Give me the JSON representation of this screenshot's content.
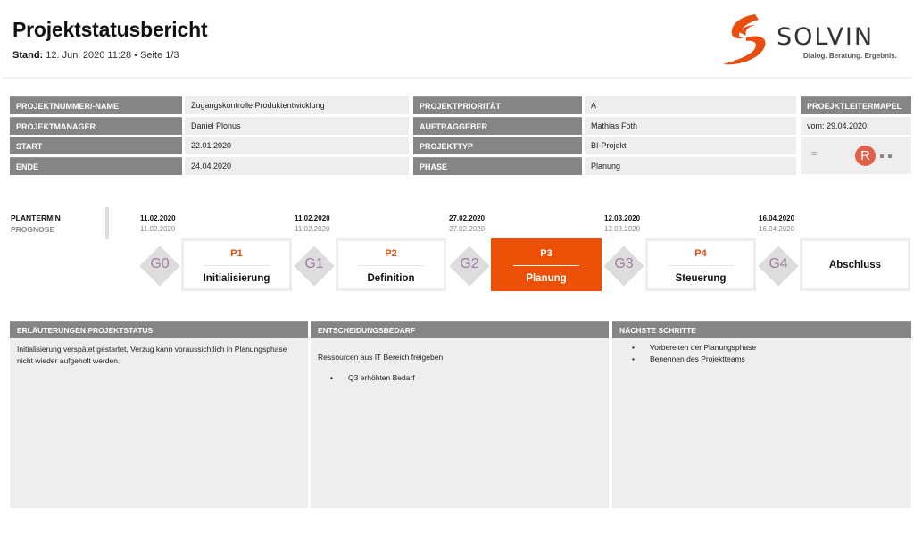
{
  "header": {
    "title": "Projektstatusbericht",
    "stand_label": "Stand:",
    "stand_value": " 12. Juni 2020 11:28 • Seite 1/3",
    "logo": {
      "brand": "SOLVIN",
      "tagline": "Dialog. Beratung. Ergebnis.",
      "brand_color": "#e84e0f"
    }
  },
  "info": {
    "left": [
      {
        "label": "PROJEKTNUMMER/-NAME",
        "value": "Zugangskontrolle Produktentwicklung"
      },
      {
        "label": "PROJEKTMANAGER",
        "value": "Daniel Plonus"
      },
      {
        "label": "START",
        "value": "22.01.2020"
      },
      {
        "label": "ENDE",
        "value": "24.04.2020"
      }
    ],
    "middle": [
      {
        "label": "PROJEKTPRIORITÄT",
        "value": "A"
      },
      {
        "label": "AUFTRAGGEBER",
        "value": "Mathias Foth"
      },
      {
        "label": "PROJEKTTYP",
        "value": "BI-Projekt"
      },
      {
        "label": "PHASE",
        "value": "Planung"
      }
    ],
    "ampel": {
      "label": "PROEJKTLEITERMAPEL",
      "date": "vom: 29.04.2020",
      "trend": "=",
      "status": "R",
      "status_color": "#e0604a"
    }
  },
  "timeline": {
    "plan_label": "PLANTERMIN",
    "prognose_label": "PROGNOSE",
    "gates": [
      {
        "id": "G0",
        "plan": "11.02.2020",
        "prognose": "11.02.2020"
      },
      {
        "id": "G1",
        "plan": "11.02.2020",
        "prognose": "11.02.2020"
      },
      {
        "id": "G2",
        "plan": "27.02.2020",
        "prognose": "27.02.2020"
      },
      {
        "id": "G3",
        "plan": "12.03.2020",
        "prognose": "12.03.2020"
      },
      {
        "id": "G4",
        "plan": "16.04.2020",
        "prognose": "16.04.2020"
      }
    ],
    "phases": [
      {
        "id": "P1",
        "name": "Initialisierung",
        "active": false
      },
      {
        "id": "P2",
        "name": "Definition",
        "active": false
      },
      {
        "id": "P3",
        "name": "Planung",
        "active": true
      },
      {
        "id": "P4",
        "name": "Steuerung",
        "active": false
      },
      {
        "id": "",
        "name": "Abschluss",
        "active": false
      }
    ],
    "active_color": "#ec5007"
  },
  "sections": {
    "erlaeuterungen": {
      "title": "ERLÄUTERUNGEN PROJEKTSTATUS",
      "text": "Initialisierung verspätet gestartet, Verzug kann voraussichtlich in Planungsphase nicht wieder aufgeholt werden."
    },
    "entscheidung": {
      "title": "ENTSCHEIDUNGSBEDARF",
      "text": "Ressourcen aus IT Bereich freigeben",
      "bullets": [
        "Q3 erhöhten Bedarf"
      ]
    },
    "naechste": {
      "title": "NÄCHSTE SCHRITTE",
      "bullets": [
        "Vorbereiten der Planungsphase",
        "Benennen des Projektteams"
      ]
    }
  }
}
